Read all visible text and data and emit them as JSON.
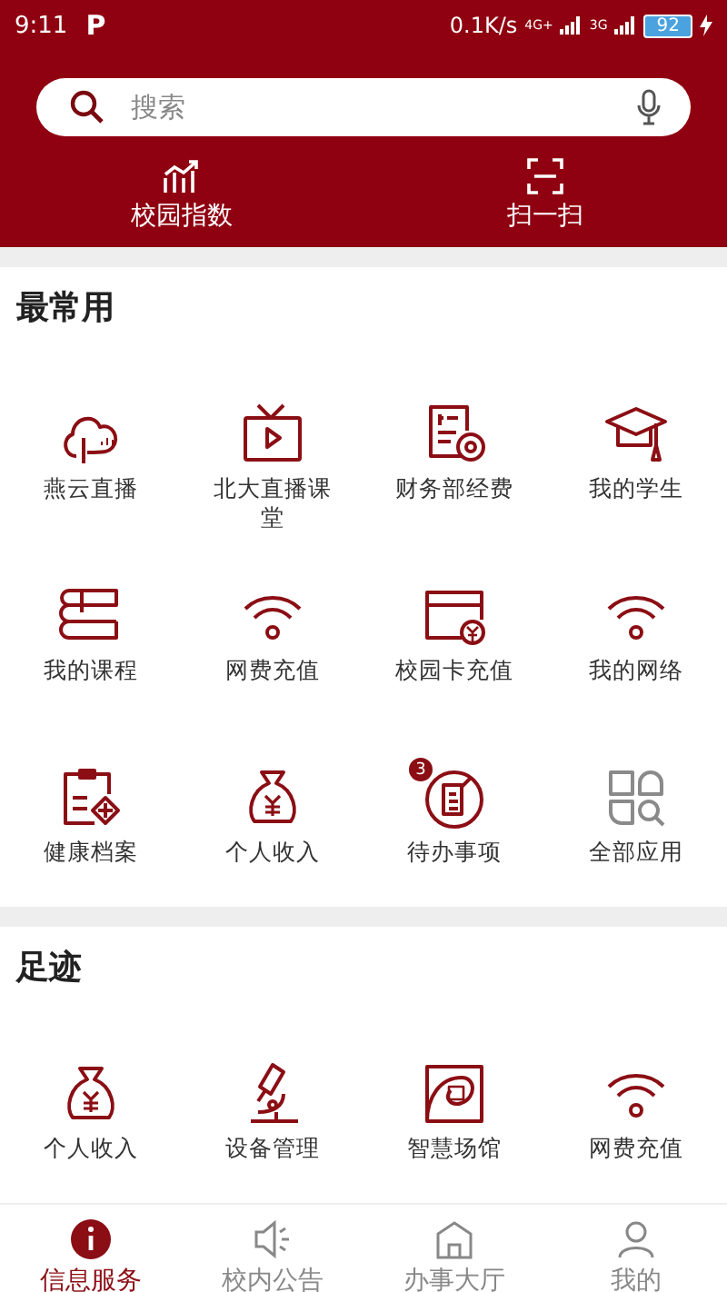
{
  "status_bar": {
    "time": "9:11",
    "app_mark": "P",
    "speed": "0.1K/s",
    "network_1": "4G+",
    "network_2": "3G",
    "battery": "92"
  },
  "search": {
    "placeholder": "搜索"
  },
  "quick_actions": [
    {
      "label": "校园指数"
    },
    {
      "label": "扫一扫"
    }
  ],
  "sections": [
    {
      "title": "最常用",
      "items": [
        {
          "label": "燕云直播"
        },
        {
          "label": "北大直播课堂"
        },
        {
          "label": "财务部经费"
        },
        {
          "label": "我的学生"
        },
        {
          "label": "我的课程"
        },
        {
          "label": "网费充值"
        },
        {
          "label": "校园卡充值"
        },
        {
          "label": "我的网络"
        },
        {
          "label": "健康档案"
        },
        {
          "label": "个人收入"
        },
        {
          "label": "待办事项",
          "badge": "3"
        },
        {
          "label": "全部应用"
        }
      ]
    },
    {
      "title": "足迹",
      "items": [
        {
          "label": "个人收入"
        },
        {
          "label": "设备管理"
        },
        {
          "label": "智慧场馆"
        },
        {
          "label": "网费充值"
        }
      ]
    }
  ],
  "bottom_nav": [
    {
      "label": "信息服务",
      "selected": true
    },
    {
      "label": "校内公告",
      "selected": false
    },
    {
      "label": "办事大厅",
      "selected": false
    },
    {
      "label": "我的",
      "selected": false
    }
  ]
}
